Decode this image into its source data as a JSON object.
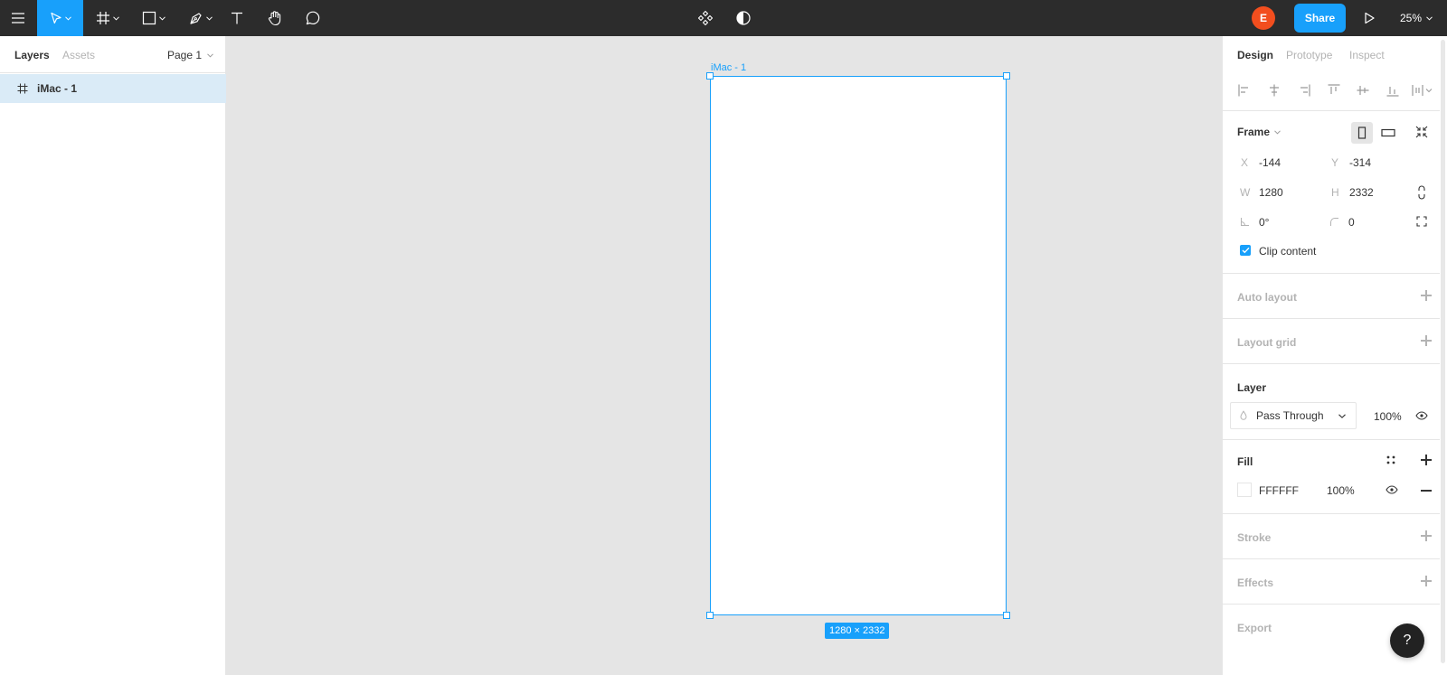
{
  "toolbar": {
    "tools": [
      "menu-icon",
      "move-icon",
      "frame-icon",
      "rectangle-icon",
      "pen-icon",
      "text-icon",
      "hand-icon",
      "comment-icon"
    ],
    "center_tools": [
      "components-icon",
      "contrast-icon"
    ],
    "avatar_initial": "E",
    "share_label": "Share",
    "zoom": "25%",
    "accent_color": "#18a0fb",
    "avatar_color": "#f24e1e"
  },
  "left_panel": {
    "tabs": [
      {
        "label": "Layers",
        "active": true
      },
      {
        "label": "Assets",
        "active": false
      }
    ],
    "page_selector": "Page 1",
    "layers": [
      {
        "name": "iMac - 1",
        "icon": "frame-icon",
        "selected": true
      }
    ]
  },
  "canvas": {
    "frame_label": "iMac - 1",
    "dimensions_badge": "1280 × 2332"
  },
  "right_panel": {
    "tabs": [
      {
        "label": "Design",
        "active": true
      },
      {
        "label": "Prototype",
        "active": false
      },
      {
        "label": "Inspect",
        "active": false
      }
    ],
    "frame": {
      "title": "Frame",
      "x_label": "X",
      "x": "-144",
      "y_label": "Y",
      "y": "-314",
      "w_label": "W",
      "w": "1280",
      "h_label": "H",
      "h": "2332",
      "rotation": "0°",
      "radius": "0",
      "clip_content_label": "Clip content",
      "clip_content": true
    },
    "auto_layout": "Auto layout",
    "layout_grid": "Layout grid",
    "layer": {
      "title": "Layer",
      "blend_mode": "Pass Through",
      "opacity": "100%"
    },
    "fill": {
      "title": "Fill",
      "hex": "FFFFFF",
      "opacity": "100%"
    },
    "stroke": "Stroke",
    "effects": "Effects",
    "export": "Export"
  },
  "help_label": "?"
}
